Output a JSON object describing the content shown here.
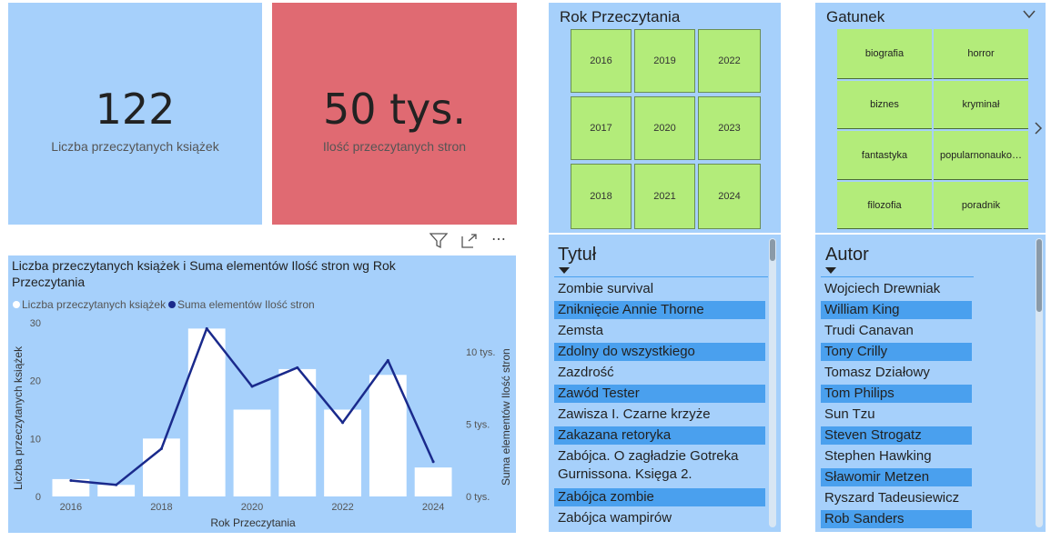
{
  "kpi1": {
    "value": "122",
    "label": "Liczba przeczytanych książek",
    "bg": "#a6d0fb"
  },
  "kpi2": {
    "value": "50 tys.",
    "label": "Ilość przeczytanych stron",
    "bg": "#e06a72"
  },
  "rok_slicer": {
    "title": "Rok Przeczytania",
    "columns": [
      [
        "2016",
        "2017",
        "2018"
      ],
      [
        "2019",
        "2020",
        "2021"
      ],
      [
        "2022",
        "2023",
        "2024"
      ]
    ]
  },
  "gatunek_slicer": {
    "title": "Gatunek",
    "tiles": [
      [
        "biografia",
        "horror"
      ],
      [
        "biznes",
        "kryminał"
      ],
      [
        "fantastyka",
        "popularnonauko…"
      ],
      [
        "filozofia",
        "poradnik"
      ]
    ]
  },
  "tytul_list": {
    "header": "Tytuł",
    "items": [
      {
        "text": "Zombie survival",
        "selected": false
      },
      {
        "text": "Zniknięcie Annie Thorne",
        "selected": true
      },
      {
        "text": "Zemsta",
        "selected": false
      },
      {
        "text": "Zdolny do wszystkiego",
        "selected": true
      },
      {
        "text": "Zazdrość",
        "selected": false
      },
      {
        "text": "Zawód Tester",
        "selected": true
      },
      {
        "text": "Zawisza I. Czarne krzyże",
        "selected": false
      },
      {
        "text": "Zakazana retoryka",
        "selected": true
      },
      {
        "text": "Zabójca. O zagładzie Gotreka",
        "text2": "Gurnissona. Księga 2.",
        "selected": false
      },
      {
        "text": "Zabójca zombie",
        "selected": true
      },
      {
        "text": "Zabójca wampirów",
        "selected": false
      }
    ]
  },
  "autor_list": {
    "header": "Autor",
    "items": [
      {
        "text": "Wojciech Drewniak",
        "selected": false
      },
      {
        "text": "William King",
        "selected": true
      },
      {
        "text": "Trudi Canavan",
        "selected": false
      },
      {
        "text": "Tony Crilly",
        "selected": true
      },
      {
        "text": "Tomasz Działowy",
        "selected": false
      },
      {
        "text": "Tom Philips",
        "selected": true
      },
      {
        "text": "Sun Tzu",
        "selected": false
      },
      {
        "text": "Steven Strogatz",
        "selected": true
      },
      {
        "text": "Stephen Hawking",
        "selected": false
      },
      {
        "text": "Sławomir Metzen",
        "selected": true
      },
      {
        "text": "Ryszard Tadeusiewicz",
        "selected": false
      },
      {
        "text": "Rob Sanders",
        "selected": true
      }
    ]
  },
  "colors": {
    "panel": "#a6d0fb",
    "tile": "#b3ec7a",
    "selected": "#4aa0ee",
    "line": "#1a2a8c",
    "bar": "#ffffff"
  },
  "chart_data": {
    "type": "bar",
    "title": "Liczba przeczytanych książek i Suma elementów Ilość stron wg Rok Przeczytania",
    "title_line1": "Liczba przeczytanych książek i Suma elementów Ilość stron wg Rok",
    "title_line2": "Przeczytania",
    "legend": [
      "Liczba przeczytanych książek",
      "Suma elementów Ilość stron"
    ],
    "xlabel": "Rok Przeczytania",
    "ylabel": "Liczba przeczytanych książek",
    "y2label": "Suma elementów Ilość stron",
    "categories": [
      2016,
      2017,
      2018,
      2019,
      2020,
      2021,
      2022,
      2023,
      2024
    ],
    "x_ticks": [
      "2016",
      "2018",
      "2020",
      "2022",
      "2024"
    ],
    "y_ticks": [
      "0",
      "10",
      "20",
      "30"
    ],
    "y2_ticks": [
      "0 tys.",
      "5 tys.",
      "10 tys."
    ],
    "ylim": [
      0,
      30
    ],
    "y2lim": [
      0,
      12000
    ],
    "series": [
      {
        "name": "Liczba przeczytanych książek",
        "type": "bar",
        "values": [
          3,
          2,
          10,
          29,
          15,
          22,
          15,
          21,
          5
        ]
      },
      {
        "name": "Suma elementów Ilość stron",
        "type": "line",
        "values": [
          1100,
          800,
          3300,
          11600,
          7600,
          8900,
          5100,
          9400,
          2400
        ]
      }
    ]
  }
}
